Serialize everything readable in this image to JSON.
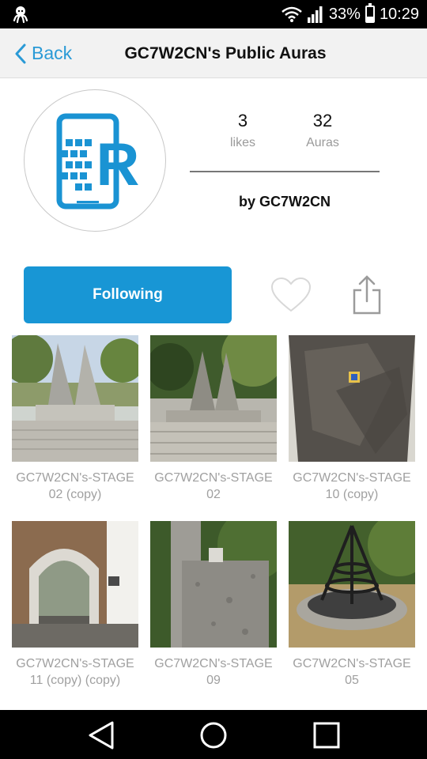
{
  "status_bar": {
    "battery": "33%",
    "time": "10:29",
    "icons": [
      "octopus-notification-icon",
      "wifi-icon",
      "signal-icon",
      "battery-icon"
    ]
  },
  "header": {
    "back_label": "Back",
    "title": "GC7W2CN's Public Auras"
  },
  "profile": {
    "likes_count": "3",
    "likes_label": "likes",
    "auras_count": "32",
    "auras_label": "Auras",
    "by_line": "by GC7W2CN"
  },
  "actions": {
    "follow_label": "Following",
    "heart_icon": "heart-icon",
    "share_icon": "share-icon"
  },
  "auras": [
    {
      "caption_line1": "GC7W2CN's-STAGE",
      "caption_line2": "02 (copy)"
    },
    {
      "caption_line1": "GC7W2CN's-STAGE",
      "caption_line2": "02"
    },
    {
      "caption_line1": "GC7W2CN's-STAGE",
      "caption_line2": "10 (copy)"
    },
    {
      "caption_line1": "GC7W2CN's-STAGE",
      "caption_line2": "11 (copy) (copy)"
    },
    {
      "caption_line1": "GC7W2CN's-STAGE",
      "caption_line2": "09"
    },
    {
      "caption_line1": "GC7W2CN's-STAGE",
      "caption_line2": "05"
    }
  ],
  "colors": {
    "accent": "#1896d5",
    "back_link": "#2a9ad6",
    "header_bg": "#f2f2f2"
  }
}
